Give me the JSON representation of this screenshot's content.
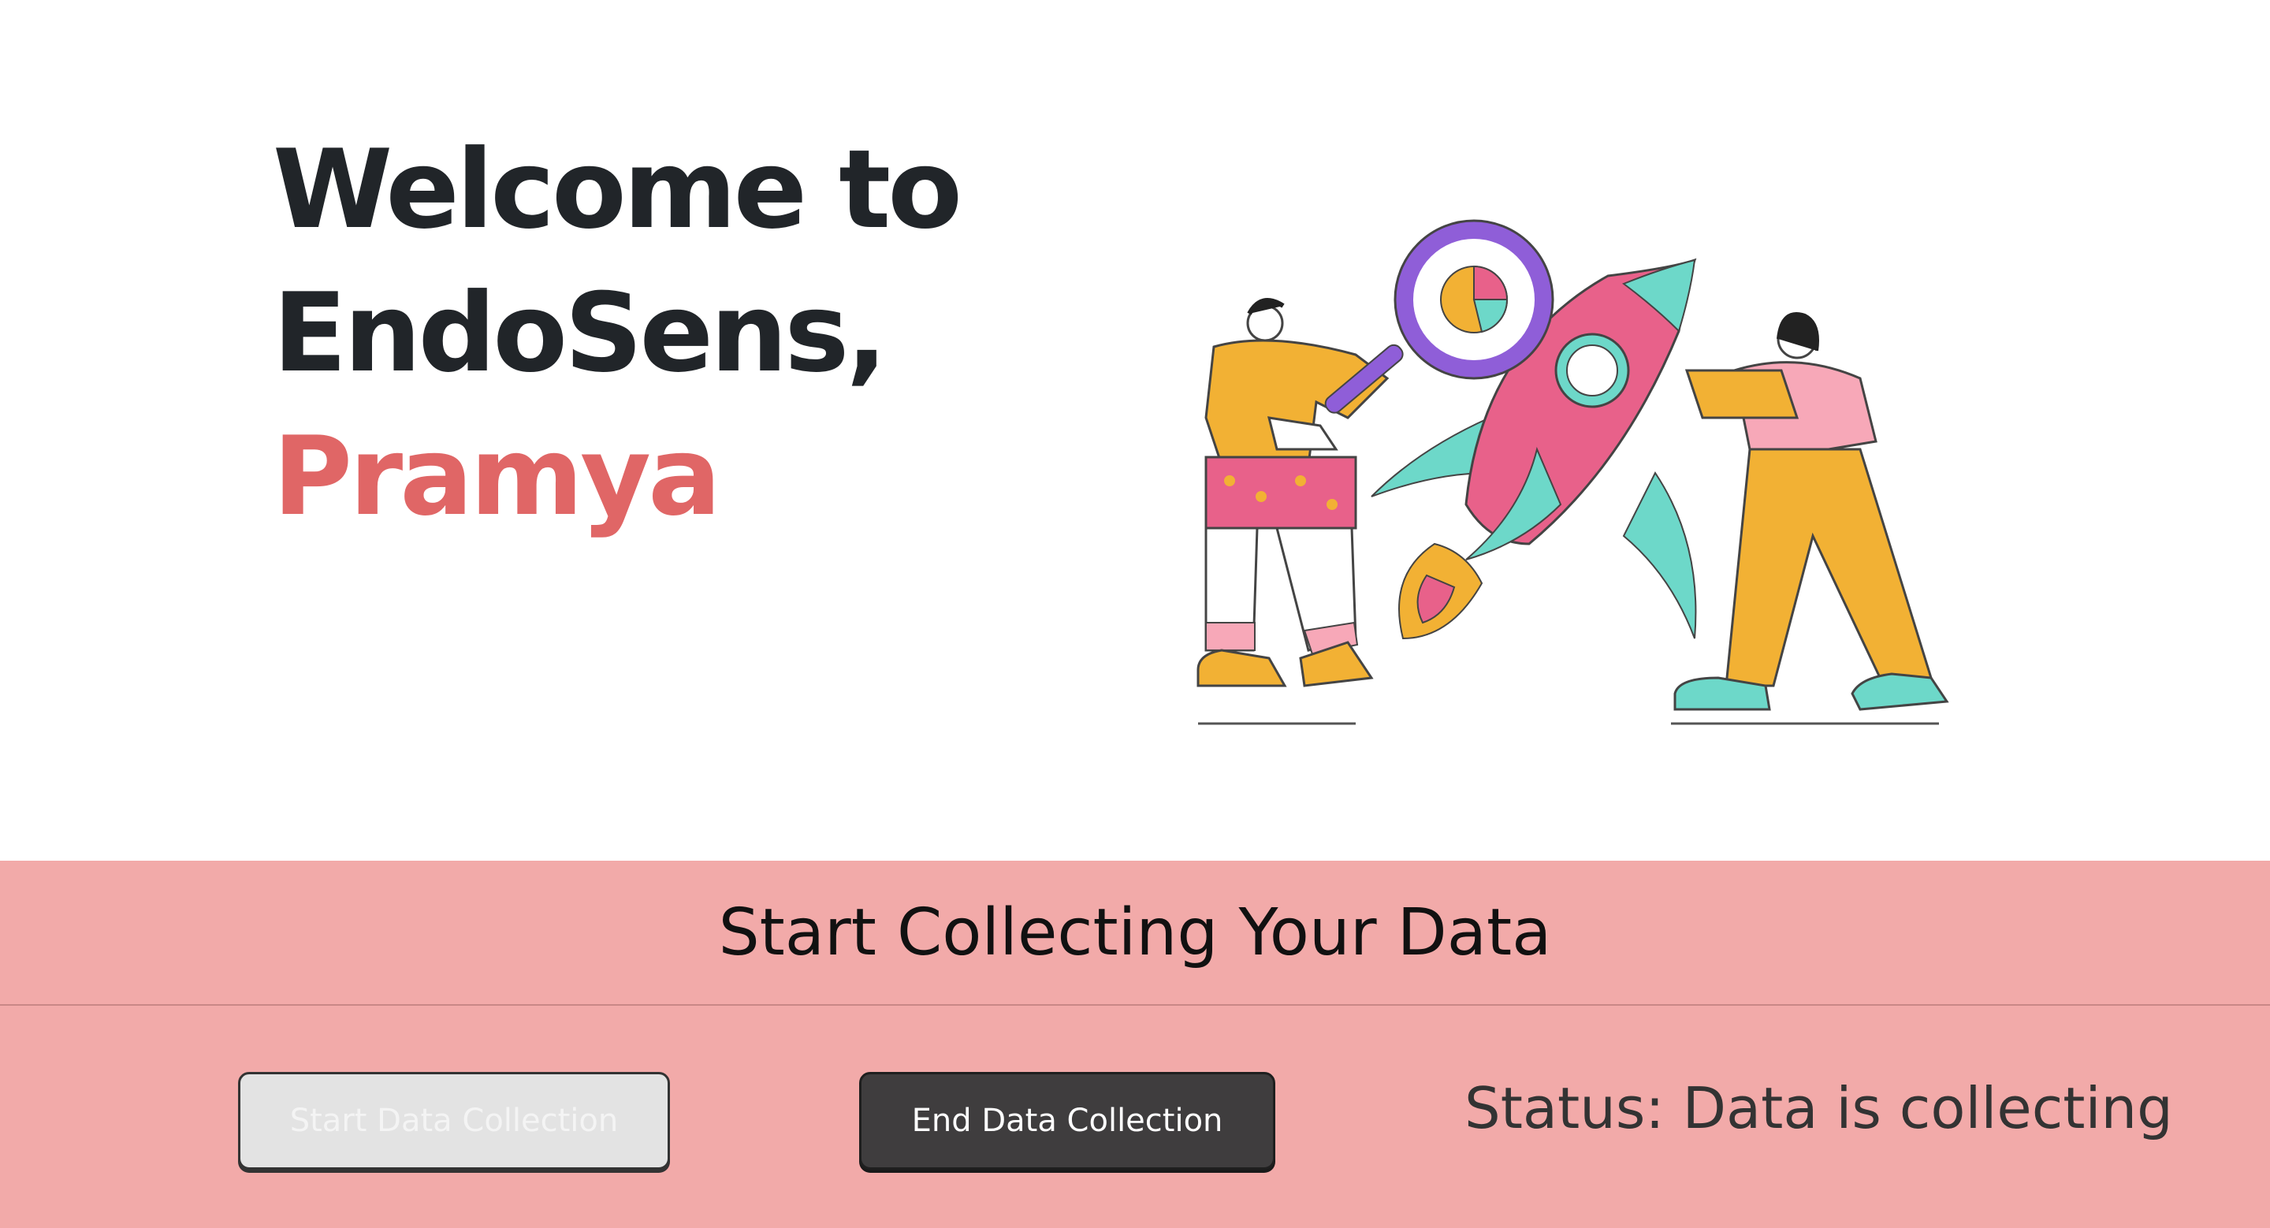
{
  "hero": {
    "welcome_line1": "Welcome to",
    "welcome_line2": "EndoSens,",
    "user_name": "Pramya",
    "illustration": "people-with-rocket-and-magnifier-illustration"
  },
  "collection": {
    "title": "Start Collecting Your Data",
    "start_button_label": "Start Data Collection",
    "end_button_label": "End Data Collection",
    "status_text": "Status: Data is collecting"
  },
  "colors": {
    "accent_name": "#e06666",
    "panel_background": "#f2aaa9",
    "heading_text": "#212529",
    "end_button": "#3f3d3e",
    "start_button_disabled": "#e3e3e3"
  }
}
